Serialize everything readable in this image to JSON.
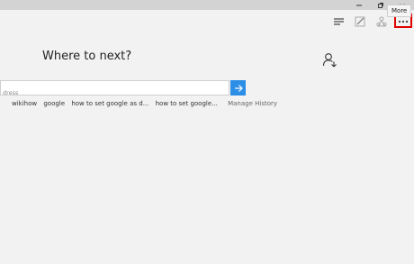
{
  "toolbar": {
    "more_tooltip": "More",
    "icons": [
      "hub-icon",
      "web-note-icon",
      "share-icon",
      "more-icon"
    ]
  },
  "newtab": {
    "heading": "Where to next?",
    "search_placeholder": "dress",
    "history_items": [
      "wikihow",
      "google",
      "how to set google as d...",
      "how to set google..."
    ],
    "manage_history": "Manage History"
  },
  "colors": {
    "go_button": "#2d8ee6",
    "highlight": "#e00000",
    "background": "#f2f2f2",
    "titlebar": "#d3d3d3"
  }
}
